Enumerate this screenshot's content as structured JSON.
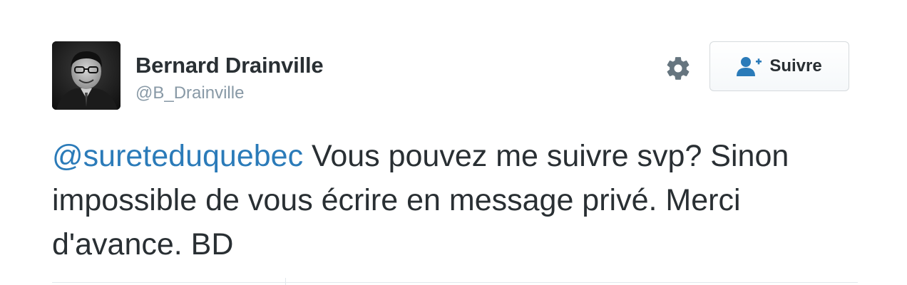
{
  "user": {
    "full_name": "Bernard Drainville",
    "screen_name": "@B_Drainville",
    "avatar_icon": "profile-photo"
  },
  "actions": {
    "settings_icon": "gear-icon",
    "follow_label": "Suivre",
    "follow_icon": "person-plus-icon"
  },
  "tweet": {
    "mention": "@sureteduquebec",
    "text": " Vous pouvez me suivre svp? Sinon impossible de vous écrire en message privé. Merci d'avance. BD"
  },
  "colors": {
    "link": "#2b7bb9",
    "text": "#292f33",
    "muted": "#8899a6",
    "icon": "#66757f",
    "follow_icon": "#2b7bb9"
  }
}
